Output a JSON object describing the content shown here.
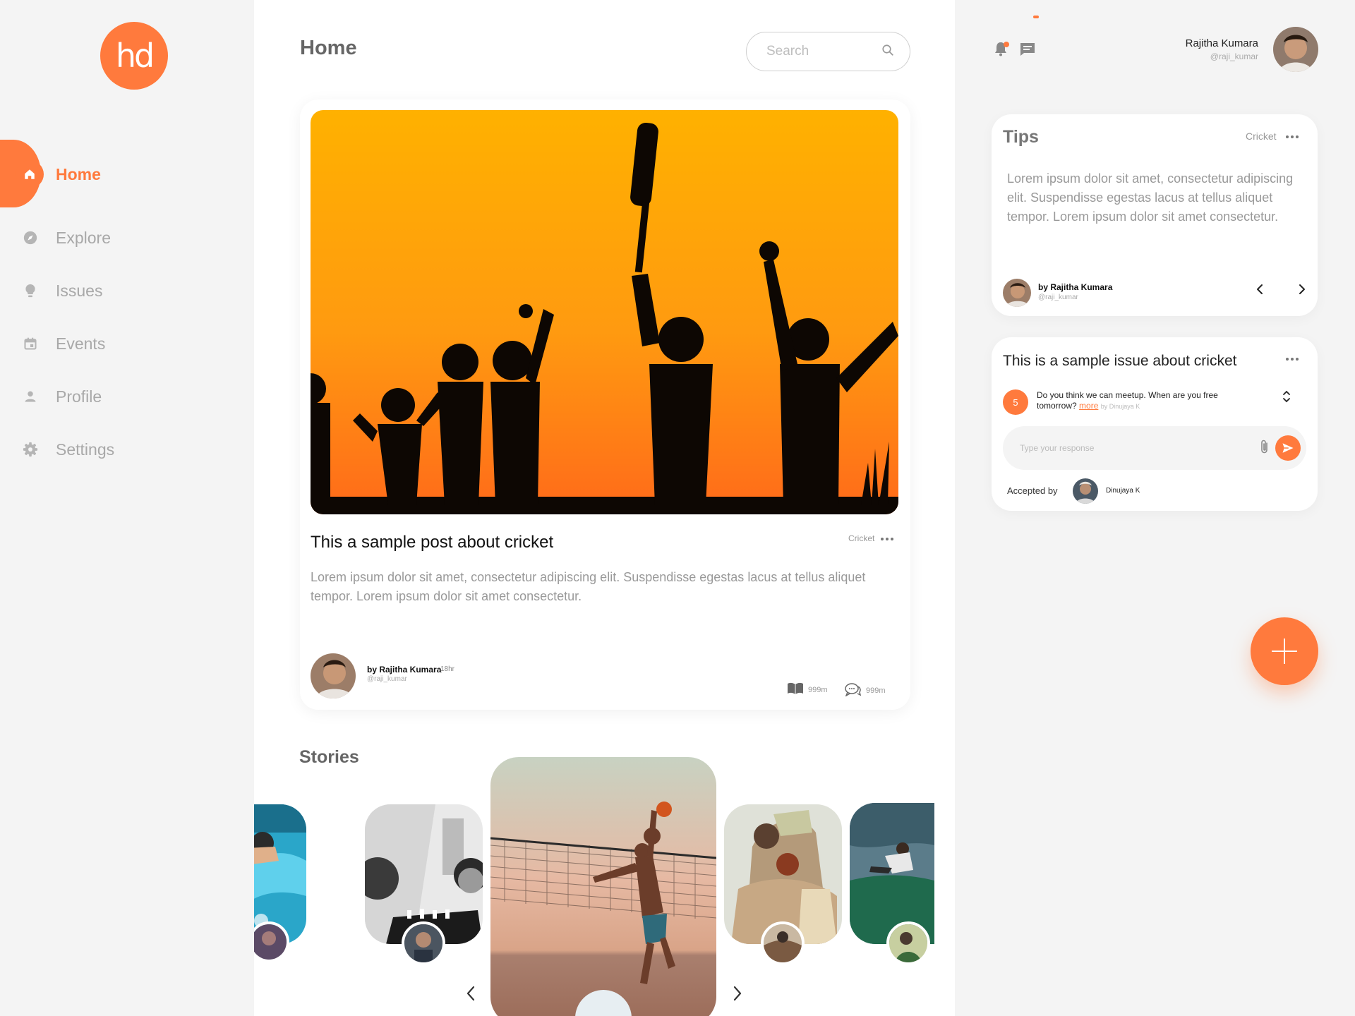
{
  "brand": {
    "logo_text": "hd",
    "accent": "#ff7a3d"
  },
  "sidebar": {
    "items": [
      {
        "label": "Home",
        "icon": "home-icon",
        "active": true
      },
      {
        "label": "Explore",
        "icon": "compass-icon"
      },
      {
        "label": "Issues",
        "icon": "lightbulb-icon"
      },
      {
        "label": "Events",
        "icon": "calendar-icon"
      },
      {
        "label": "Profile",
        "icon": "person-icon"
      },
      {
        "label": "Settings",
        "icon": "gear-icon"
      }
    ]
  },
  "header": {
    "title": "Home",
    "search_placeholder": "Search"
  },
  "post": {
    "title": "This a sample post about cricket",
    "tag": "Cricket",
    "body": "Lorem ipsum dolor sit amet, consectetur adipiscing elit. Suspendisse egestas lacus at tellus aliquet tempor. Lorem ipsum dolor sit amet consectetur.",
    "author": "by Rajitha Kumara",
    "time": "18hr",
    "handle": "@raji_kumar",
    "likes": "999m",
    "comments": "999m"
  },
  "stories": {
    "title": "Stories"
  },
  "user": {
    "name": "Rajitha Kumara",
    "handle": "@raji_kumar"
  },
  "tips": {
    "title": "Tips",
    "tag": "Cricket",
    "body": "Lorem ipsum dolor sit amet, consectetur adipiscing elit. Suspendisse egestas lacus at tellus aliquet tempor. Lorem ipsum dolor sit amet consectetur.",
    "author": "by Rajitha Kumara",
    "handle": "@raji_kumar"
  },
  "issue": {
    "title": "This is a sample issue about cricket",
    "count": "5",
    "question": "Do you think we can meetup. When are you free tomorrow?",
    "more": "more",
    "by": "by Dinujaya K",
    "reply_placeholder": "Type your response",
    "accepted_label": "Accepted by",
    "accepted_name": "Dinujaya K"
  }
}
